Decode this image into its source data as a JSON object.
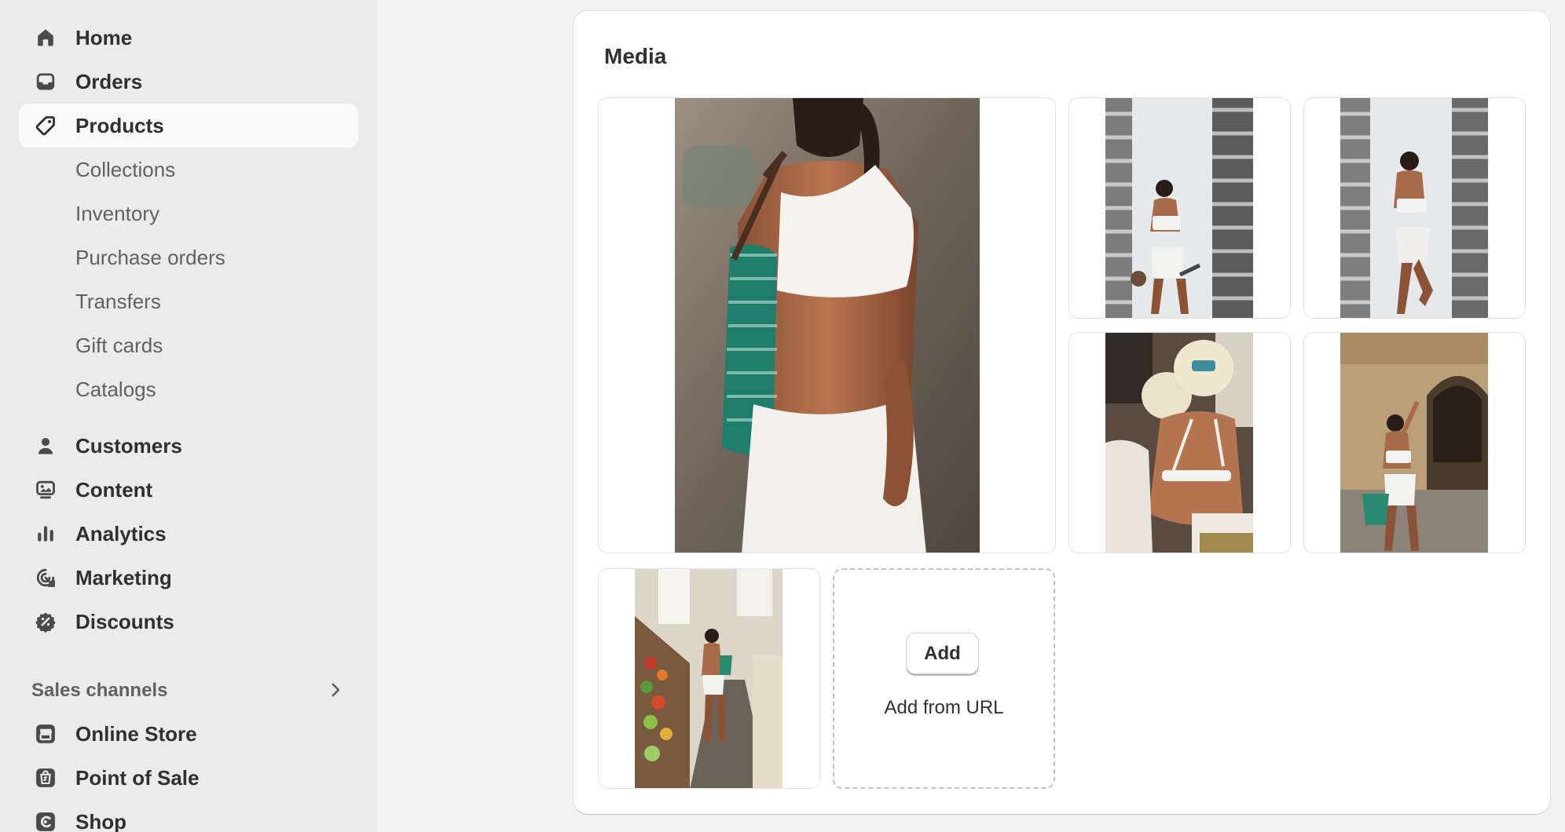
{
  "sidebar": {
    "items": [
      {
        "label": "Home",
        "icon": "home-icon"
      },
      {
        "label": "Orders",
        "icon": "inbox-icon"
      },
      {
        "label": "Products",
        "icon": "tag-icon"
      }
    ],
    "product_subitems": [
      {
        "label": "Collections"
      },
      {
        "label": "Inventory"
      },
      {
        "label": "Purchase orders"
      },
      {
        "label": "Transfers"
      },
      {
        "label": "Gift cards"
      },
      {
        "label": "Catalogs"
      }
    ],
    "items2": [
      {
        "label": "Customers",
        "icon": "person-icon"
      },
      {
        "label": "Content",
        "icon": "image-content-icon"
      },
      {
        "label": "Analytics",
        "icon": "bar-chart-icon"
      },
      {
        "label": "Marketing",
        "icon": "target-icon"
      },
      {
        "label": "Discounts",
        "icon": "discount-badge-icon"
      }
    ],
    "sales_channels": {
      "label": "Sales channels",
      "items": [
        {
          "label": "Online Store",
          "icon": "storefront-icon"
        },
        {
          "label": "Point of Sale",
          "icon": "pos-bag-icon"
        },
        {
          "label": "Shop",
          "icon": "shop-app-icon"
        }
      ]
    }
  },
  "media": {
    "title": "Media",
    "add_button_label": "Add",
    "add_from_url_label": "Add from URL"
  },
  "colors": {
    "sidebar_bg": "#ebebeb",
    "page_bg": "#f1f1f1",
    "card_bg": "#ffffff",
    "text": "#303030",
    "muted_text": "#616161"
  }
}
